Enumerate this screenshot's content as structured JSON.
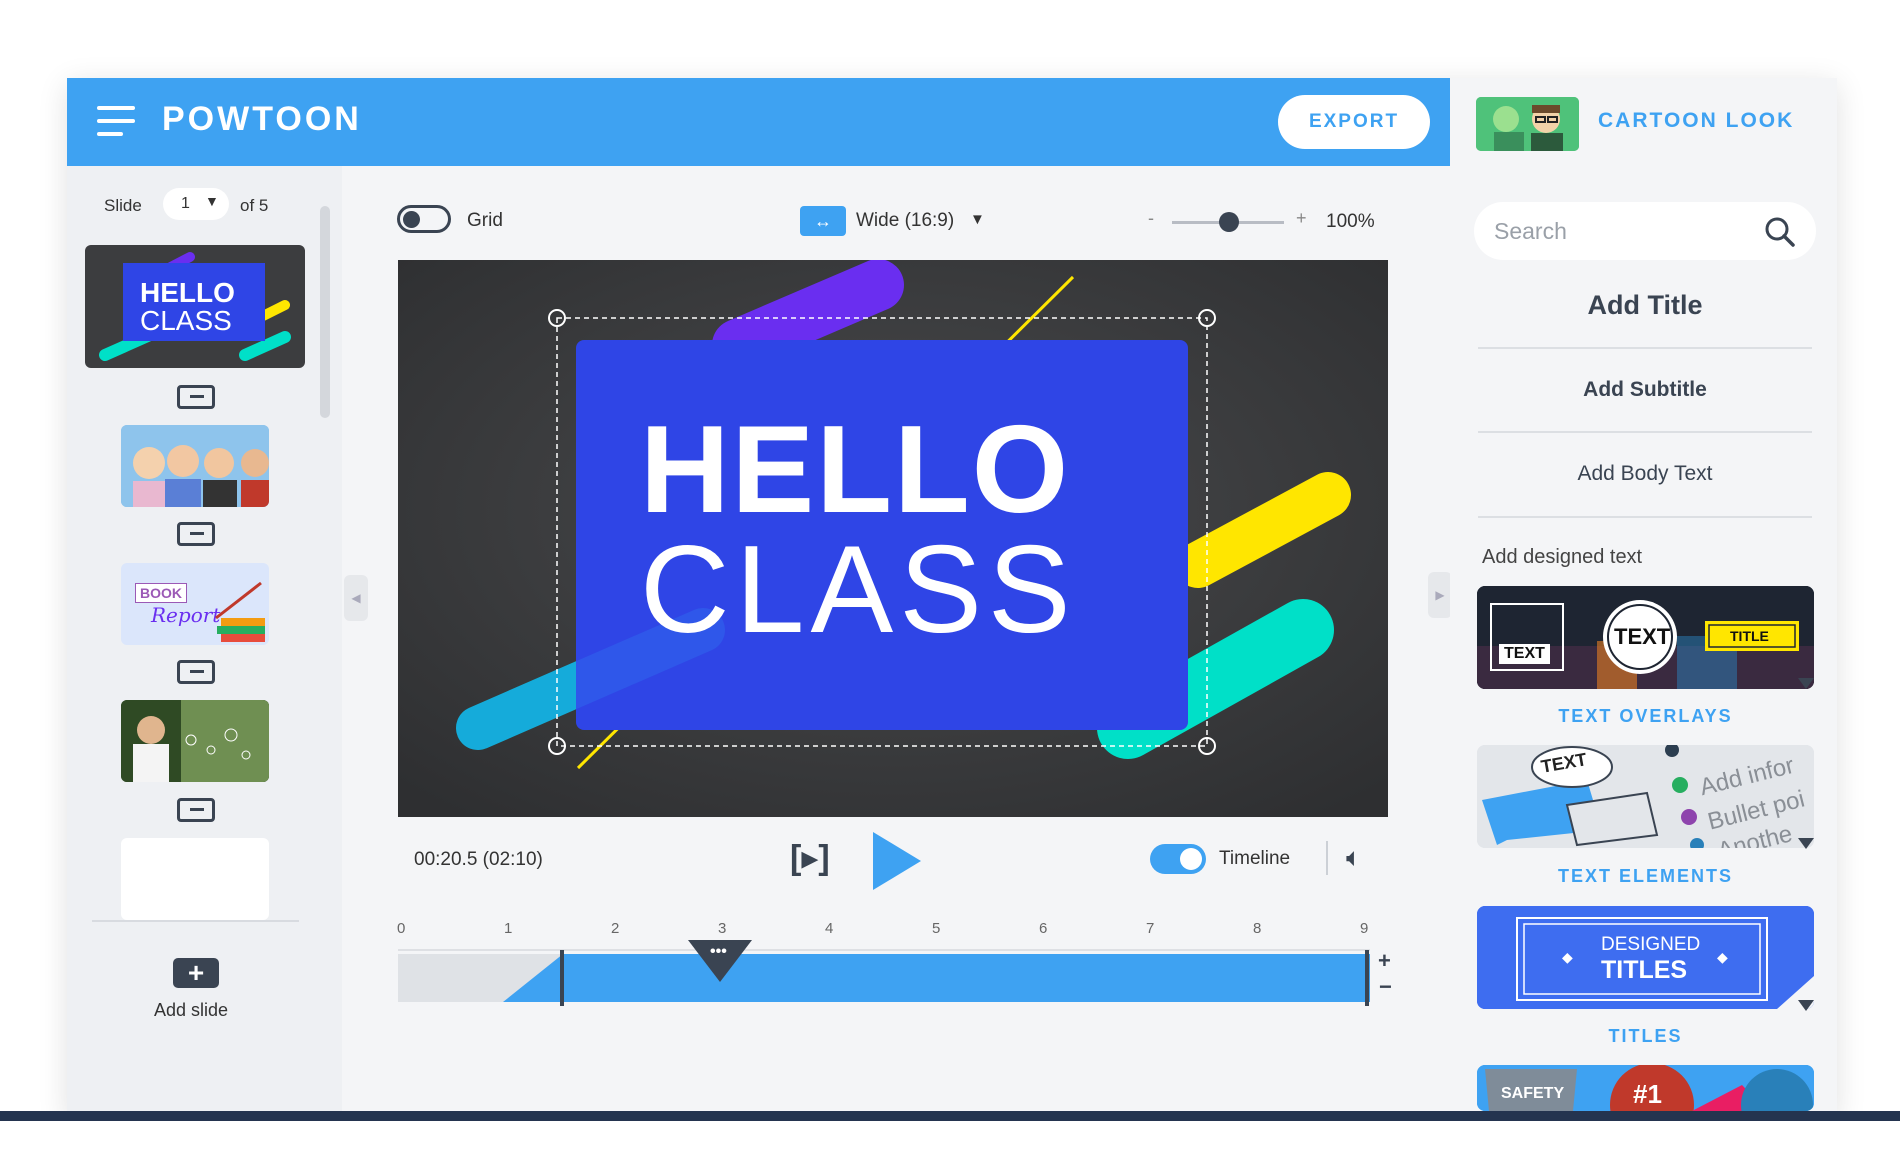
{
  "header": {
    "logo": "POWTOON",
    "export_label": "EXPORT",
    "style_label": "CARTOON LOOK"
  },
  "slides_panel": {
    "slide_label": "Slide",
    "current_slide": "1",
    "of_label": "of 5",
    "first_slide_text": [
      "HELLO",
      "CLASS"
    ],
    "book_report_text": [
      "BOOK",
      "Report"
    ],
    "add_slide_label": "Add slide"
  },
  "toolbar": {
    "grid_label": "Grid",
    "aspect_label": "Wide (16:9)",
    "zoom_minus": "-",
    "zoom_plus": "+",
    "zoom_value": "100%"
  },
  "canvas": {
    "title_line1": "HELLO",
    "title_line2": "CLASS"
  },
  "playback": {
    "time": "00:20.5 (02:10)",
    "timeline_label": "Timeline"
  },
  "timeline": {
    "ticks": [
      "0",
      "1",
      "2",
      "3",
      "4",
      "5",
      "6",
      "7",
      "8",
      "9"
    ],
    "zoom_in": "+",
    "zoom_out": "−"
  },
  "right_panel": {
    "search_placeholder": "Search",
    "add_title": "Add Title",
    "add_subtitle": "Add Subtitle",
    "add_body": "Add Body Text",
    "designed_text_label": "Add designed text",
    "categories": [
      {
        "label": "TEXT OVERLAYS",
        "thumb_texts": [
          "TEXT",
          "TEXT",
          "TITLE"
        ]
      },
      {
        "label": "TEXT ELEMENTS",
        "thumb_texts": [
          "TEXT",
          "Add infor",
          "Bullet poi",
          "Anothe"
        ]
      },
      {
        "label": "TITLES",
        "thumb_texts": [
          "DESIGNED",
          "TITLES"
        ]
      }
    ],
    "badge_texts": [
      "SAFETY",
      "#1"
    ]
  },
  "colors": {
    "brand_blue": "#3ea2f2",
    "canvas_blue": "#2f45e6",
    "accent_yellow": "#ffe600",
    "accent_teal": "#00e0c8",
    "accent_purple": "#6a2ef0",
    "dark": "#3a4452"
  }
}
